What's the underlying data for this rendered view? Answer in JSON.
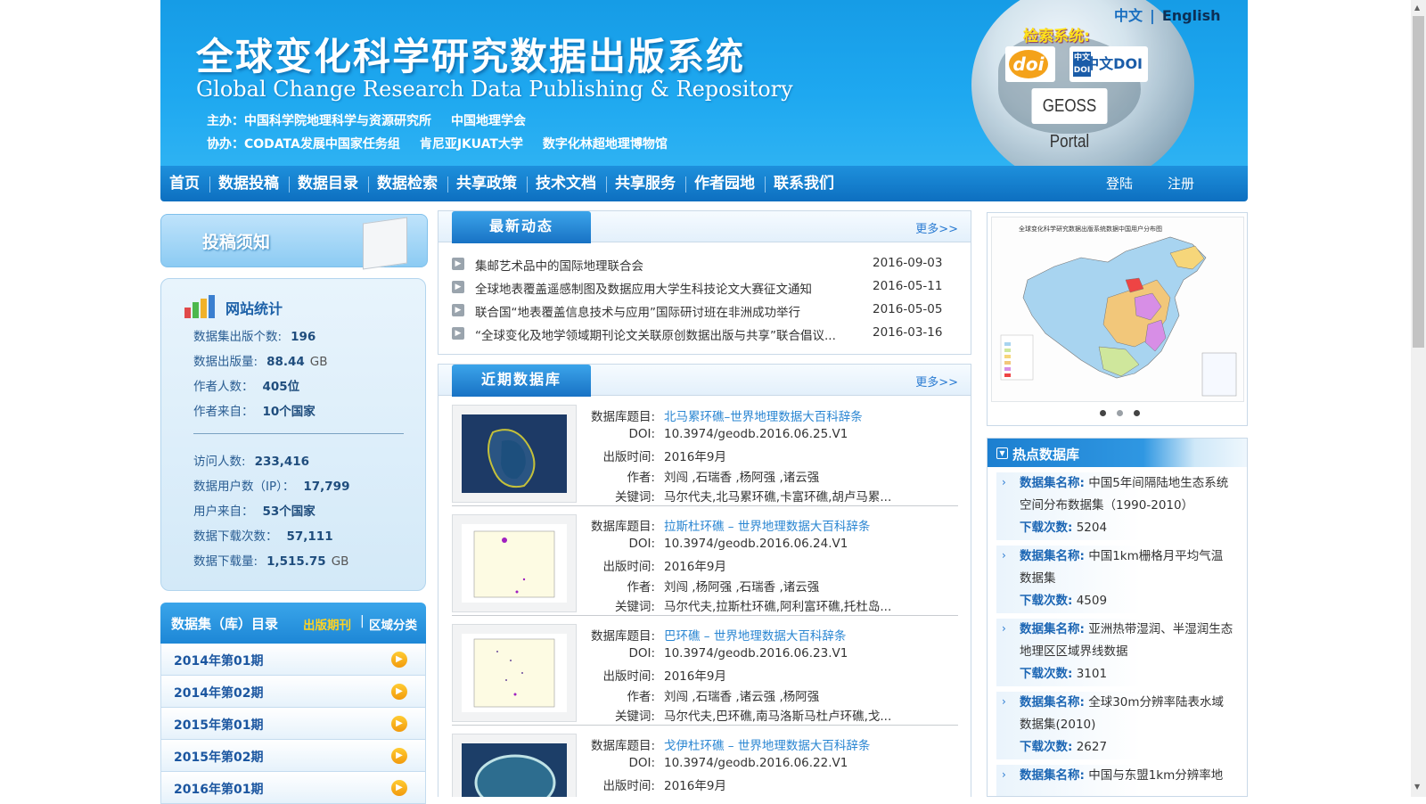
{
  "header": {
    "title_cn": "全球变化科学研究数据出版系统",
    "title_en": "Global Change Research Data Publishing & Repository",
    "host_label": "主办：",
    "hosts": [
      "中国科学院地理科学与资源研究所",
      "中国地理学会"
    ],
    "co_label": "协办：",
    "co_hosts": [
      "CODATA发展中国家任务组",
      "肯尼亚JKUAT大学",
      "数字化林超地理博物馆"
    ],
    "lang_cn": "中文",
    "lang_sep": "|",
    "lang_en": "English",
    "search_title": "检索系统:",
    "doi_text": "doi",
    "cn_doi_text": "中文DOI",
    "cn_doi_mark": "中文 DOI",
    "geoss_text": "GEOSS Portal"
  },
  "nav": {
    "items": [
      "首页",
      "数据投稿",
      "数据目录",
      "数据检索",
      "共享政策",
      "技术文档",
      "共享服务",
      "作者园地",
      "联系我们"
    ],
    "login": "登陆",
    "register": "注册"
  },
  "sidebar": {
    "tougao": "投稿须知",
    "stats_title": "网站统计",
    "stats": {
      "datasets_label": "数据集出版个数:",
      "datasets_value": "196",
      "volume_label": "数据出版量:",
      "volume_value": "88.44",
      "volume_unit": "GB",
      "authors_label": "作者人数：",
      "authors_value": "405位",
      "author_from_label": "作者来自：",
      "author_from_value": "10个国家",
      "separator": "————————————————",
      "visitors_label": "访问人数:",
      "visitors_value": "233,416",
      "users_label": "数据用户数（IP）：",
      "users_value": "17,799",
      "user_from_label": "用户来自：",
      "user_from_value": "53个国家",
      "downloads_label": "数据下载次数：",
      "downloads_value": "57,111",
      "dl_volume_label": "数据下载量:",
      "dl_volume_value": "1,515.75",
      "dl_volume_unit": "GB"
    },
    "catalog_title": "数据集（库）目录",
    "catalog_tab_a": "出版期刊",
    "catalog_sep": "|",
    "catalog_tab_b": "区域分类",
    "catalog_items": [
      "2014年第01期",
      "2014年第02期",
      "2015年第01期",
      "2015年第02期",
      "2016年第01期"
    ]
  },
  "news": {
    "title": "最新动态",
    "more": "更多>>",
    "items": [
      {
        "title": "集邮艺术品中的国际地理联合会",
        "date": "2016-09-03"
      },
      {
        "title": "全球地表覆盖遥感制图及数据应用大学生科技论文大赛征文通知",
        "date": "2016-05-11"
      },
      {
        "title": "联合国“地表覆盖信息技术与应用”国际研讨班在非洲成功举行",
        "date": "2016-05-05"
      },
      {
        "title": "“全球变化及地学领域期刊论文关联原创数据出版与共享”联合倡议...",
        "date": "2016-03-16"
      }
    ]
  },
  "recent": {
    "title": "近期数据库",
    "more": "更多>>",
    "labels": {
      "title": "数据库题目:",
      "doi": "DOI:",
      "date": "出版时间:",
      "authors": "作者:",
      "keywords": "关键词:"
    },
    "items": [
      {
        "title": "北马累环礁–世界地理数据大百科辞条",
        "doi": "10.3974/geodb.2016.06.25.V1",
        "date": "2016年9月",
        "authors": "刘闯 ,石瑞香 ,杨阿强 ,诸云强",
        "keywords": "马尔代夫,北马累环礁,卡富环礁,胡卢马累..."
      },
      {
        "title": "拉斯杜环礁 – 世界地理数据大百科辞条",
        "doi": "10.3974/geodb.2016.06.24.V1",
        "date": "2016年9月",
        "authors": "刘闯 ,杨阿强 ,石瑞香 ,诸云强",
        "keywords": "马尔代夫,拉斯杜环礁,阿利富环礁,托杜岛..."
      },
      {
        "title": "巴环礁 – 世界地理数据大百科辞条",
        "doi": "10.3974/geodb.2016.06.23.V1",
        "date": "2016年9月",
        "authors": "刘闯 ,石瑞香 ,诸云强 ,杨阿强",
        "keywords": "马尔代夫,巴环礁,南马洛斯马杜卢环礁,戈..."
      },
      {
        "title": "戈伊杜环礁 – 世界地理数据大百科辞条",
        "doi": "10.3974/geodb.2016.06.22.V1",
        "date": "2016年9月",
        "authors": "",
        "keywords": ""
      }
    ]
  },
  "map": {
    "caption": "全球变化科学研究数据出版系统数据中国用户分布图"
  },
  "hot": {
    "title": "热点数据库",
    "name_label": "数据集名称:",
    "dl_label": "下载次数:",
    "items": [
      {
        "name": "中国5年间隔陆地生态系统空间分布数据集（1990-2010）",
        "downloads": "5204"
      },
      {
        "name": "中国1km栅格月平均气温数据集",
        "downloads": "4509"
      },
      {
        "name": "亚洲热带湿润、半湿润生态地理区区域界线数据",
        "downloads": "3101"
      },
      {
        "name": "全球30m分辨率陆表水域数据集(2010)",
        "downloads": "2627"
      },
      {
        "name": "中国与东盟1km分辨率地",
        "downloads": ""
      }
    ]
  }
}
